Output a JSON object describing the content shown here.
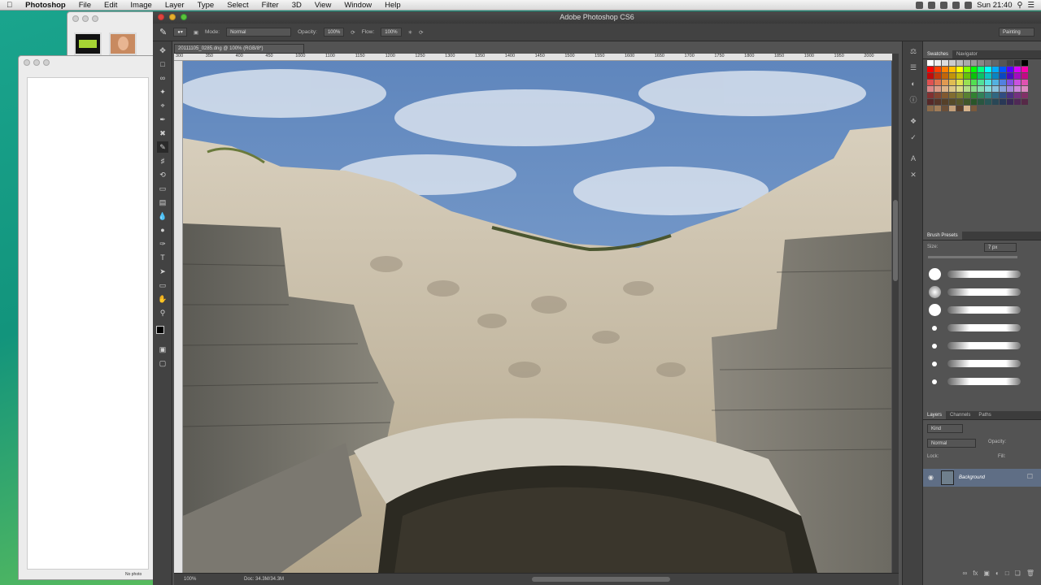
{
  "menubar": {
    "app_name": "Photoshop",
    "items": [
      "File",
      "Edit",
      "Image",
      "Layer",
      "Type",
      "Select",
      "Filter",
      "3D",
      "View",
      "Window",
      "Help"
    ],
    "clock": "Sun 21:40"
  },
  "photoshop": {
    "window_title": "Adobe Photoshop CS6",
    "options": {
      "mode_label": "Mode:",
      "mode_value": "Normal",
      "opacity_label": "Opacity:",
      "opacity_value": "100%",
      "flow_label": "Flow:",
      "flow_value": "100%",
      "workspace": "Painting"
    },
    "document_tab": "20111105_0285.dng @ 100% (RGB/8*)",
    "ruler_ticks": [
      "300",
      "350",
      "400",
      "450",
      "1000",
      "1100",
      "1150",
      "1200",
      "1250",
      "1300",
      "1350",
      "1400",
      "1450",
      "1500",
      "1550",
      "1600",
      "1650",
      "1700",
      "1750",
      "1800",
      "1850",
      "1900",
      "1950",
      "2000"
    ],
    "status": {
      "zoom": "100%",
      "doc_size": "Doc: 34.3M/34.3M"
    },
    "panels": {
      "swatches_tabs": [
        "Swatches",
        "Navigator"
      ],
      "brush_tab": "Brush Presets",
      "brush_size_label": "Size:",
      "brush_size_value": "7 px",
      "brush_sizes": [
        "",
        "",
        "",
        "",
        "",
        "",
        ""
      ],
      "layers_tabs": [
        "Layers",
        "Channels",
        "Paths"
      ],
      "layers_kind": "Kind",
      "layers_blend": "Normal",
      "layers_opacity_label": "Opacity:",
      "layers_lock_label": "Lock:",
      "layers_fill_label": "Fill:",
      "layer_name": "Background"
    }
  },
  "background": {
    "status_text": "No photo"
  },
  "colors": {
    "ps_dark": "#424242",
    "ps_mid": "#535353",
    "sky": "#6e95c9",
    "stone": "#c4b9a3",
    "layer_highlight": "#5f6e85"
  }
}
